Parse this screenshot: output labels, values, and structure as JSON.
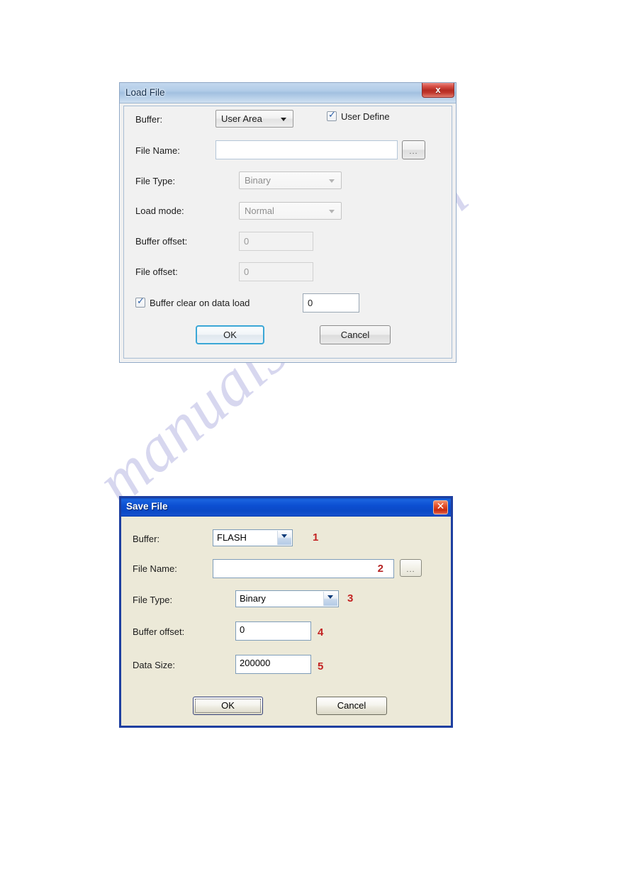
{
  "watermark": {
    "text": "manualshive.com"
  },
  "load_dialog": {
    "title": "Load File",
    "close_label": "x",
    "fields": {
      "buffer_label": "Buffer:",
      "buffer_value": "User Area",
      "user_define_label": "User Define",
      "user_define_checked": "✓",
      "file_name_label": "File Name:",
      "file_name_value": "",
      "browse_label": "...",
      "file_type_label": "File Type:",
      "file_type_value": "Binary",
      "load_mode_label": "Load mode:",
      "load_mode_value": "Normal",
      "buffer_offset_label": "Buffer offset:",
      "buffer_offset_value": "0",
      "file_offset_label": "File offset:",
      "file_offset_value": "0",
      "buffer_clear_label": "Buffer clear on data load",
      "buffer_clear_checked": "✓",
      "buffer_clear_value": "0"
    },
    "buttons": {
      "ok": "OK",
      "cancel": "Cancel"
    }
  },
  "save_dialog": {
    "title": "Save File",
    "close_label": "✕",
    "fields": {
      "buffer_label": "Buffer:",
      "buffer_value": "FLASH",
      "file_name_label": "File Name:",
      "file_name_value": "",
      "browse_label": "...",
      "file_type_label": "File Type:",
      "file_type_value": "Binary",
      "buffer_offset_label": "Buffer offset:",
      "buffer_offset_value": "0",
      "data_size_label": "Data Size:",
      "data_size_value": "200000"
    },
    "buttons": {
      "ok": "OK",
      "cancel": "Cancel"
    },
    "annotations": {
      "a1": "1",
      "a2": "2",
      "a3": "3",
      "a4": "4",
      "a5": "5"
    }
  },
  "colors": {
    "xp_titlebar": "#0c4fd2",
    "xp_face": "#ece9d8",
    "aero_face": "#f1f1f1",
    "annotation_red": "#c32222",
    "watermark": "#c9c9ea"
  }
}
